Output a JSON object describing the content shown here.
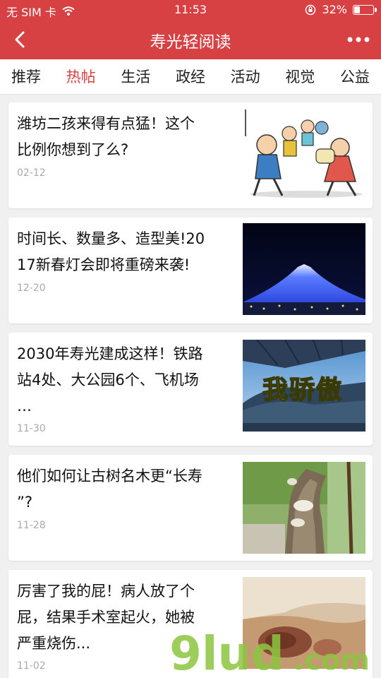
{
  "status_bar": {
    "carrier": "无 SIM 卡",
    "time": "11:53",
    "battery_percent": "32%",
    "battery_level": 0.32
  },
  "nav": {
    "title": "寿光轻阅读"
  },
  "tabs": [
    {
      "label": "推荐",
      "active": false
    },
    {
      "label": "热帖",
      "active": true
    },
    {
      "label": "生活",
      "active": false
    },
    {
      "label": "政经",
      "active": false
    },
    {
      "label": "活动",
      "active": false
    },
    {
      "label": "视觉",
      "active": false
    },
    {
      "label": "公益",
      "active": false
    }
  ],
  "articles": [
    {
      "title_lines": [
        "潍坊二孩来得有点猛！这个",
        "比例你想到了么?"
      ],
      "date": "02-12",
      "thumb": "cartoon-family-image"
    },
    {
      "title_lines": [
        "时间长、数量多、造型美!20",
        "17新春灯会即将重磅来袭!"
      ],
      "date": "12-20",
      "thumb": "lantern-festival-image"
    },
    {
      "title_lines": [
        "2030年寿光建成这样！铁路",
        "站4处、大公园6个、飞机场",
        "…"
      ],
      "date": "11-30",
      "thumb": "station-image",
      "thumb_caption": "我骄傲"
    },
    {
      "title_lines": [
        "他们如何让古树名木更“长寿",
        "”?"
      ],
      "date": "11-28",
      "thumb": "old-tree-image"
    },
    {
      "title_lines": [
        "厉害了我的屁！病人放了个",
        "屁，结果手术室起火，她被",
        "严重烧伤..."
      ],
      "date": "11-02",
      "thumb": "burned-skin-image"
    }
  ],
  "watermark": {
    "text_main": "9lud",
    "text_suffix": ".com",
    "color": "#8cc63f"
  }
}
